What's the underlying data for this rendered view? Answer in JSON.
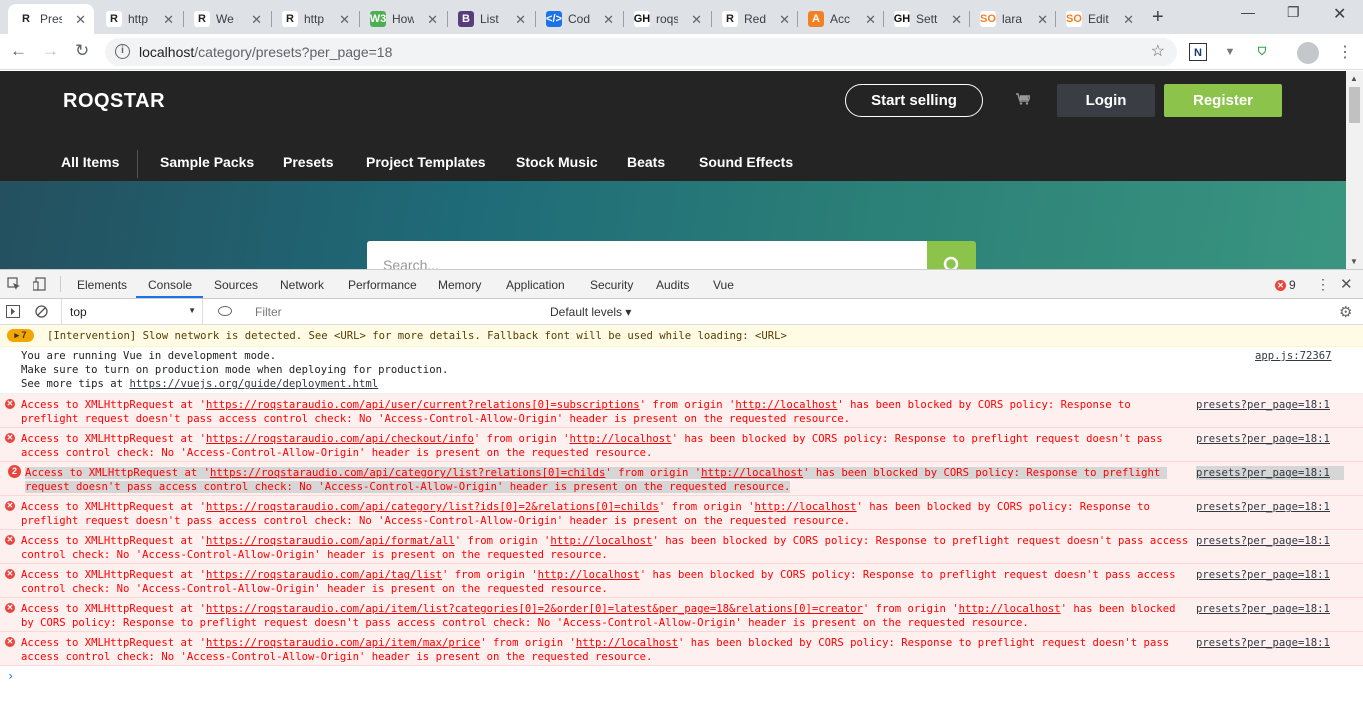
{
  "browser": {
    "tabs": [
      {
        "icon": "R",
        "title": "Pres"
      },
      {
        "icon": "R",
        "title": "http"
      },
      {
        "icon": "R",
        "title": "We h"
      },
      {
        "icon": "R",
        "title": "http"
      },
      {
        "icon": "W3",
        "title": "How"
      },
      {
        "icon": "B",
        "title": "List"
      },
      {
        "icon": "</>",
        "title": "Cod"
      },
      {
        "icon": "GH",
        "title": "roqs"
      },
      {
        "icon": "R",
        "title": "Redi"
      },
      {
        "icon": "A",
        "title": "Acc"
      },
      {
        "icon": "GH",
        "title": "Sett"
      },
      {
        "icon": "SO",
        "title": "lara"
      },
      {
        "icon": "SO",
        "title": "Edit"
      }
    ],
    "url_host": "localhost",
    "url_path": "/category/presets?per_page=18"
  },
  "site": {
    "logo": "ROQSTAR",
    "start_selling": "Start selling",
    "login": "Login",
    "register": "Register",
    "categories": [
      "All Items",
      "Sample Packs",
      "Presets",
      "Project Templates",
      "Stock Music",
      "Beats",
      "Sound Effects"
    ],
    "search_placeholder": "Search..."
  },
  "devtools": {
    "tabs": [
      "Elements",
      "Console",
      "Sources",
      "Network",
      "Performance",
      "Memory",
      "Application",
      "Security",
      "Audits",
      "Vue"
    ],
    "active_tab": "Console",
    "error_count": "9",
    "context": "top",
    "filter_placeholder": "Filter",
    "levels": "Default levels"
  },
  "console": {
    "warning": {
      "count": "7",
      "text": "[Intervention] Slow network is detected. See <URL> for more details. Fallback font will be used while loading: <URL>"
    },
    "info": {
      "line1": "You are running Vue in development mode.",
      "line2": "Make sure to turn on production mode when deploying for production.",
      "line3_prefix": "See more tips at ",
      "line3_link": "https://vuejs.org/guide/deployment.html",
      "source": "app.js:72367"
    },
    "errors": [
      {
        "pre": "Access to XMLHttpRequest at '",
        "url": "https://roqstaraudio.com/api/user/current?relations[0]=subscriptions",
        "mid": "' from origin '",
        "origin": "http://localhost",
        "post": "' has been blocked by CORS policy: Response to preflight request doesn't pass access control check: No 'Access-Control-Allow-Origin' header is present on the requested resource.",
        "source": "presets?per_page=18:1"
      },
      {
        "pre": "Access to XMLHttpRequest at '",
        "url": "https://roqstaraudio.com/api/checkout/info",
        "mid": "' from origin '",
        "origin": "http://localhost",
        "post": "' has been blocked by CORS policy: Response to preflight request doesn't pass access control check: No 'Access-Control-Allow-Origin' header is present on the requested resource.",
        "source": "presets?per_page=18:1"
      },
      {
        "repeat": "2",
        "pre": "Access to XMLHttpRequest at '",
        "url": "https://roqstaraudio.com/api/category/list?relations[0]=childs",
        "mid": "' from origin '",
        "origin": "http://localhost",
        "post": "' has been blocked by CORS policy: Response to preflight request doesn't pass access control check: No 'Access-Control-Allow-Origin' header is present on the requested resource.",
        "source": "presets?per_page=18:1"
      },
      {
        "pre": "Access to XMLHttpRequest at '",
        "url": "https://roqstaraudio.com/api/category/list?ids[0]=2&relations[0]=childs",
        "mid": "' from origin '",
        "origin": "http://localhost",
        "post": "' has been blocked by CORS policy: Response to preflight request doesn't pass access control check: No 'Access-Control-Allow-Origin' header is present on the requested resource.",
        "source": "presets?per_page=18:1"
      },
      {
        "pre": "Access to XMLHttpRequest at '",
        "url": "https://roqstaraudio.com/api/format/all",
        "mid": "' from origin '",
        "origin": "http://localhost",
        "post": "' has been blocked by CORS policy: Response to preflight request doesn't pass access control check: No 'Access-Control-Allow-Origin' header is present on the requested resource.",
        "source": "presets?per_page=18:1"
      },
      {
        "pre": "Access to XMLHttpRequest at '",
        "url": "https://roqstaraudio.com/api/tag/list",
        "mid": "' from origin '",
        "origin": "http://localhost",
        "post": "' has been blocked by CORS policy: Response to preflight request doesn't pass access control check: No 'Access-Control-Allow-Origin' header is present on the requested resource.",
        "source": "presets?per_page=18:1"
      },
      {
        "pre": "Access to XMLHttpRequest at '",
        "url": "https://roqstaraudio.com/api/item/list?categories[0]=2&order[0]=latest&per_page=18&relations[0]=creator",
        "mid": "' from origin '",
        "origin": "http://localhost",
        "post": "' has been blocked by CORS policy: Response to preflight request doesn't pass access control check: No 'Access-Control-Allow-Origin' header is present on the requested resource.",
        "source": "presets?per_page=18:1"
      },
      {
        "pre": "Access to XMLHttpRequest at '",
        "url": "https://roqstaraudio.com/api/item/max/price",
        "mid": "' from origin '",
        "origin": "http://localhost",
        "post": "' has been blocked by CORS policy: Response to preflight request doesn't pass access control check: No 'Access-Control-Allow-Origin' header is present on the requested resource.",
        "source": "presets?per_page=18:1"
      }
    ]
  },
  "colors": {
    "brand_green": "#8cc34b",
    "header_dark": "#242424",
    "error_red": "#e8453c"
  }
}
